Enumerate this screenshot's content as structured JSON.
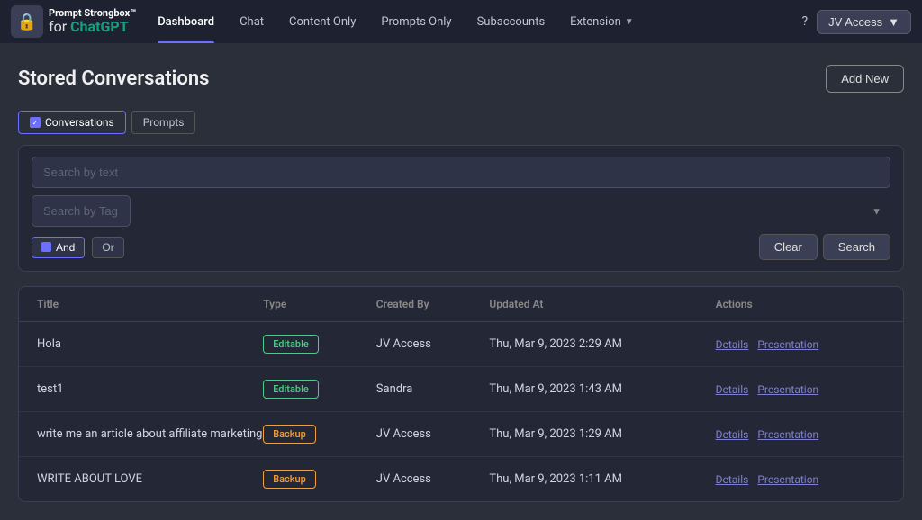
{
  "app": {
    "logo_icon": "🔒",
    "brand_name": "Prompt Strongbox™",
    "brand_sub": "for",
    "brand_chatgpt": "ChatGPT"
  },
  "nav": {
    "items": [
      {
        "label": "Dashboard",
        "active": true
      },
      {
        "label": "Chat",
        "active": false
      },
      {
        "label": "Content Only",
        "active": false
      },
      {
        "label": "Prompts Only",
        "active": false
      },
      {
        "label": "Subaccounts",
        "active": false
      },
      {
        "label": "Extension",
        "active": false,
        "has_arrow": true
      }
    ],
    "help": "?",
    "access_label": "JV Access",
    "access_arrow": "▼"
  },
  "page": {
    "title": "Stored Conversations",
    "add_new_label": "Add New"
  },
  "filter_tabs": [
    {
      "label": "Conversations",
      "active": true
    },
    {
      "label": "Prompts",
      "active": false
    }
  ],
  "search": {
    "text_placeholder": "Search by text",
    "tag_placeholder": "Search by Tag",
    "logic_and": "And",
    "logic_or": "Or",
    "clear_label": "Clear",
    "search_label": "Search"
  },
  "table": {
    "headers": [
      "Title",
      "Type",
      "Created By",
      "Updated At",
      "Actions"
    ],
    "rows": [
      {
        "title": "Hola",
        "type": "Editable",
        "type_style": "editable",
        "created_by": "JV Access",
        "updated_at": "Thu, Mar 9, 2023 2:29 AM",
        "actions": [
          "Details",
          "Presentation"
        ]
      },
      {
        "title": "test1",
        "type": "Editable",
        "type_style": "editable",
        "created_by": "Sandra",
        "updated_at": "Thu, Mar 9, 2023 1:43 AM",
        "actions": [
          "Details",
          "Presentation"
        ]
      },
      {
        "title": "write me an article about affiliate marketing",
        "type": "Backup",
        "type_style": "backup",
        "created_by": "JV Access",
        "updated_at": "Thu, Mar 9, 2023 1:29 AM",
        "actions": [
          "Details",
          "Presentation"
        ]
      },
      {
        "title": "WRITE ABOUT LOVE",
        "type": "Backup",
        "type_style": "backup",
        "created_by": "JV Access",
        "updated_at": "Thu, Mar 9, 2023 1:11 AM",
        "actions": [
          "Details",
          "Presentation"
        ]
      }
    ]
  }
}
